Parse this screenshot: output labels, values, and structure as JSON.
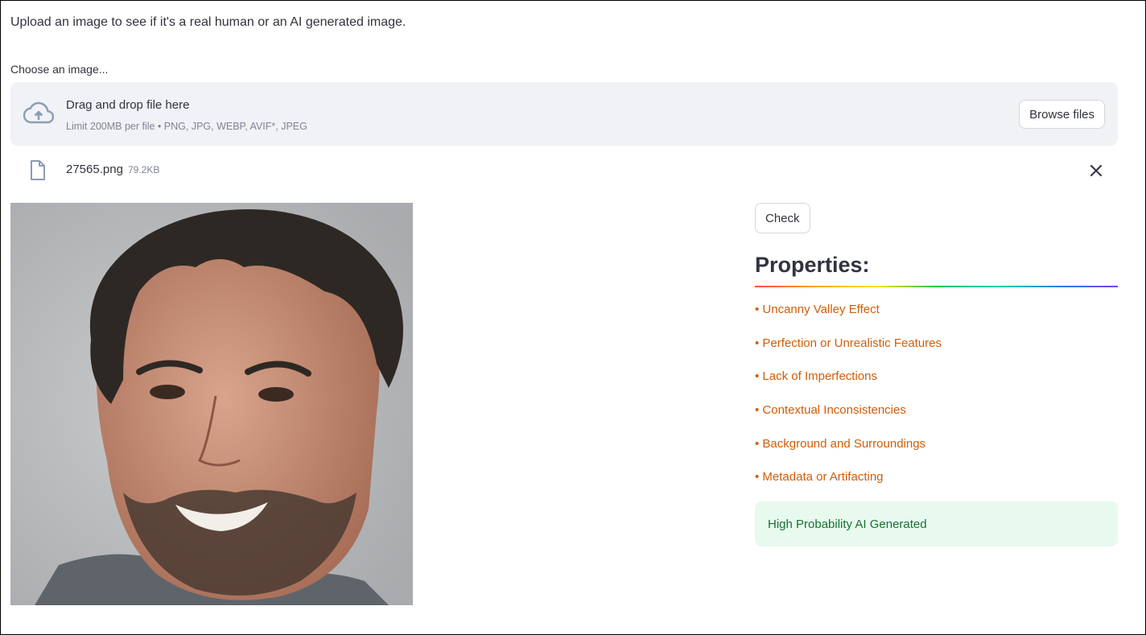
{
  "intro_text": "Upload an image to see if it's a real human or an AI generated image.",
  "uploader": {
    "label": "Choose an image...",
    "drop_title": "Drag and drop file here",
    "limit_text": "Limit 200MB per file • PNG, JPG, WEBP, AVIF*, JPEG",
    "browse_label": "Browse files",
    "icon": "cloud-upload-icon"
  },
  "file": {
    "name": "27565.png",
    "size": "79.2KB",
    "icon": "file-icon",
    "remove_icon": "close-icon"
  },
  "check_label": "Check",
  "properties": {
    "title": "Properties:",
    "items": [
      "• Uncanny Valley Effect",
      "• Perfection or Unrealistic Features",
      "• Lack of Imperfections",
      "• Contextual Inconsistencies",
      "• Background and Surroundings",
      "• Metadata or Artifacting"
    ]
  },
  "result": {
    "text": "High Probability AI Generated"
  },
  "colors": {
    "accent_text": "#d15d06",
    "success_bg": "#e8f9ee",
    "success_text": "#177233",
    "dropzone_bg": "#f0f2f6"
  }
}
